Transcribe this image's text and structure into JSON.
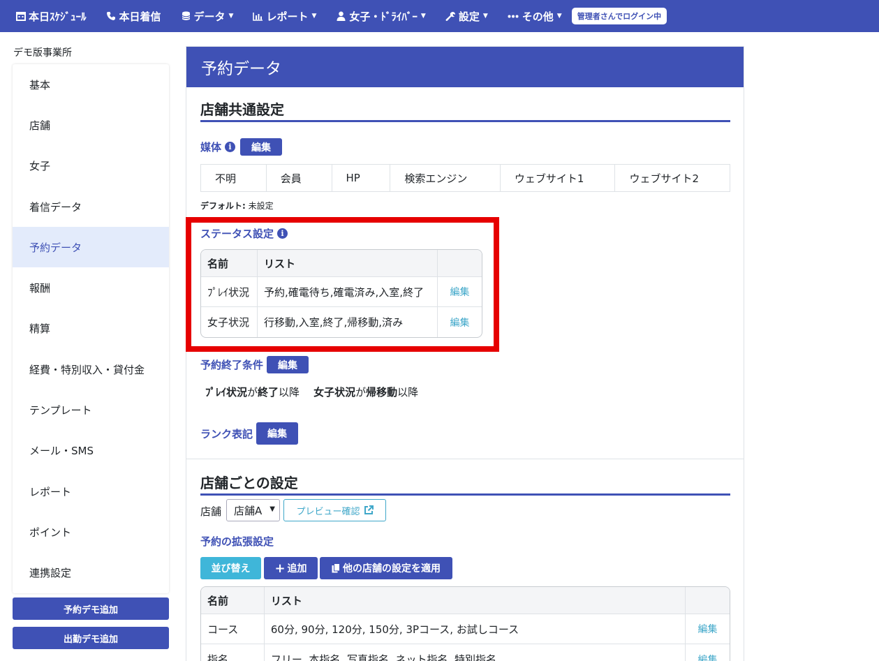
{
  "nav": {
    "items": [
      {
        "label": "本日ｽｹｼﾞｭｰﾙ",
        "icon": "calendar-icon",
        "caret": false
      },
      {
        "label": "本日着信",
        "icon": "phone-icon",
        "caret": false
      },
      {
        "label": "データ",
        "icon": "database-icon",
        "caret": true
      },
      {
        "label": "レポート",
        "icon": "bar-chart-icon",
        "caret": true
      },
      {
        "label": "女子・ﾄﾞﾗｲﾊﾞｰ",
        "icon": "user-icon",
        "caret": true
      },
      {
        "label": "設定",
        "icon": "wrench-icon",
        "caret": true
      },
      {
        "label": "その他",
        "icon": "ellipsis-icon",
        "caret": true
      }
    ],
    "login_badge": "管理者さんでログイン中"
  },
  "sidebar": {
    "office": "デモ版事業所",
    "items": [
      {
        "label": "基本"
      },
      {
        "label": "店舗"
      },
      {
        "label": "女子"
      },
      {
        "label": "着信データ"
      },
      {
        "label": "予約データ"
      },
      {
        "label": "報酬"
      },
      {
        "label": "精算"
      },
      {
        "label": "経費・特別収入・貸付金"
      },
      {
        "label": "テンプレート"
      },
      {
        "label": "メール・SMS"
      },
      {
        "label": "レポート"
      },
      {
        "label": "ポイント"
      },
      {
        "label": "連携設定"
      }
    ],
    "active_index": 4,
    "demo_reserve_button": "予約デモ追加",
    "demo_attend_button": "出勤デモ追加"
  },
  "main": {
    "title": "予約データ",
    "common": {
      "section_title": "店舗共通設定",
      "media_label": "媒体",
      "edit_label": "編集",
      "media": [
        "不明",
        "会員",
        "HP",
        "検索エンジン",
        "ウェブサイト1",
        "ウェブサイト2"
      ],
      "default_label": "デフォルト:",
      "default_value": "未設定",
      "status_label": "ステータス設定",
      "status_table": {
        "headers": [
          "名前",
          "リスト",
          ""
        ],
        "rows": [
          {
            "name": "ﾌﾟﾚｲ状況",
            "list": "予約,確電待ち,確電済み,入室,終了",
            "action": "編集"
          },
          {
            "name": "女子状況",
            "list": "行移動,入室,終了,帰移動,済み",
            "action": "編集"
          }
        ]
      },
      "end_cond_label": "予約終了条件",
      "end_cond": {
        "a_name": "ﾌﾟﾚｲ状況",
        "a_mid": "が",
        "a_value": "終了",
        "a_after": "以降",
        "b_name": "女子状況",
        "b_mid": "が",
        "b_value": "帰移動",
        "b_after": "以降"
      },
      "rank_label": "ランク表記"
    },
    "per_shop": {
      "section_title": "店舗ごとの設定",
      "shop_label": "店舗",
      "shop_value": "店舗A",
      "preview_button": "プレビュー確認",
      "ext_label": "予約の拡張設定",
      "sort_button": "並び替え",
      "add_button": "追加",
      "apply_button": "他の店舗の設定を適用",
      "table": {
        "headers": [
          "名前",
          "リスト",
          ""
        ],
        "rows": [
          {
            "name": "コース",
            "list": "60分, 90分, 120分, 150分, 3Pコース, お試しコース",
            "action": "編集"
          },
          {
            "name": "指名",
            "list": "フリー, 本指名, 写真指名, ネット指名, 特別指名",
            "action": "編集"
          }
        ]
      }
    }
  },
  "colors": {
    "brand": "#3f51b5",
    "highlight_border": "#e60000",
    "info_button": "#3fb6d9",
    "link": "#3fa7c9"
  }
}
